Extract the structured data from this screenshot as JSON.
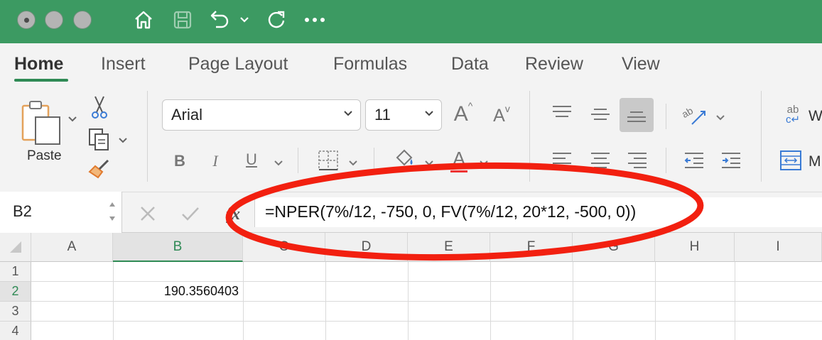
{
  "window": {
    "accent_color": "#3c9a62",
    "toolbar_icons": [
      "home-icon",
      "save-icon",
      "undo-icon",
      "chevron-down-icon",
      "redo-icon",
      "more-icon"
    ]
  },
  "ribbon": {
    "tabs": [
      {
        "label": "Home",
        "active": true
      },
      {
        "label": "Insert"
      },
      {
        "label": "Page Layout"
      },
      {
        "label": "Formulas"
      },
      {
        "label": "Data"
      },
      {
        "label": "Review"
      },
      {
        "label": "View"
      }
    ],
    "paste_label": "Paste",
    "font_name": "Arial",
    "font_size": "11",
    "bold": "B",
    "italic": "I",
    "underline": "U",
    "grow_font": "A",
    "shrink_font": "A",
    "font_color": "A",
    "wrap_text_icon_label": "ab",
    "wrap_text_partial": "W",
    "merge_partial": "M"
  },
  "formula_bar": {
    "name_box": "B2",
    "fx": "fx",
    "formula": "=NPER(7%/12, -750, 0, FV(7%/12, 20*12, -500, 0))"
  },
  "grid": {
    "columns": [
      "A",
      "B",
      "C",
      "D",
      "E",
      "F",
      "G",
      "H",
      "I"
    ],
    "selected_column": "B",
    "rows": [
      "1",
      "2",
      "3",
      "4"
    ],
    "selected_row": "2",
    "cells": {
      "B2": "190.3560403"
    }
  },
  "annotation": {
    "color": "#f22010",
    "shape": "ellipse"
  }
}
